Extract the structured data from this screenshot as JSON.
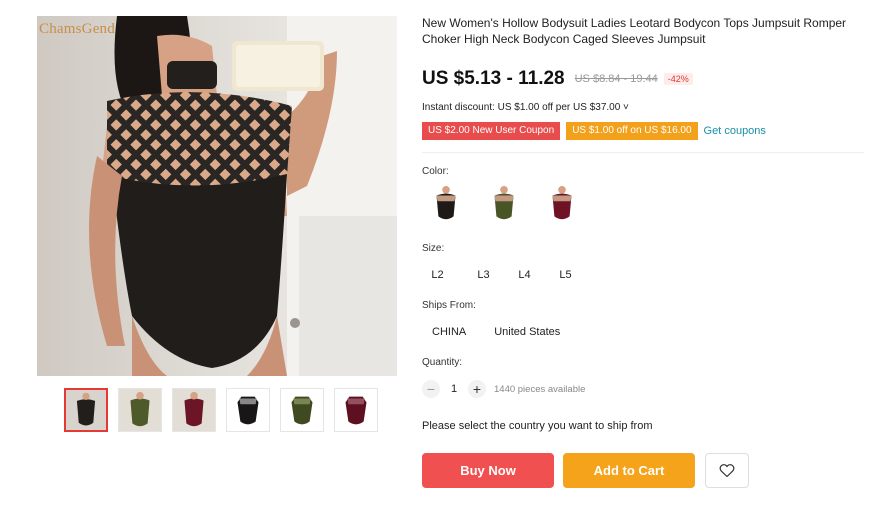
{
  "brand": "ChamsGend",
  "product": {
    "title": "New Women's Hollow Bodysuit Ladies Leotard Bodycon Tops Jumpsuit Romper Choker High Neck Bodycon Caged Sleeves Jumpsuit",
    "price": "US $5.13 - 11.28",
    "old_price": "US $8.84 - 19.44",
    "discount": "-42%"
  },
  "instant_discount": "Instant discount: US $1.00 off per US $37.00 ˅",
  "coupons": [
    {
      "label": "US $2.00 New User Coupon",
      "color": "#e94c4c"
    },
    {
      "label": "US $1.00 off on US $16.00",
      "color": "#f3a01a"
    }
  ],
  "get_coupons": "Get coupons",
  "color": {
    "label": "Color:",
    "options": [
      "black",
      "army green",
      "wine red"
    ]
  },
  "size": {
    "label": "Size:",
    "options": [
      "L2",
      "L3",
      "L4",
      "L5"
    ]
  },
  "ships_from": {
    "label": "Ships From:",
    "options": [
      "CHINA",
      "United States"
    ]
  },
  "quantity": {
    "label": "Quantity:",
    "value": "1",
    "minus": "−",
    "plus": "+",
    "available": "1440 pieces available"
  },
  "ship_message": "Please select the country you want to ship from",
  "buttons": {
    "buy_now": "Buy Now",
    "add_to_cart": "Add to Cart"
  },
  "colors": {
    "buy": "#f0504f",
    "cart": "#f5a31a",
    "accent_red": "#e53935",
    "link": "#1890a8"
  }
}
